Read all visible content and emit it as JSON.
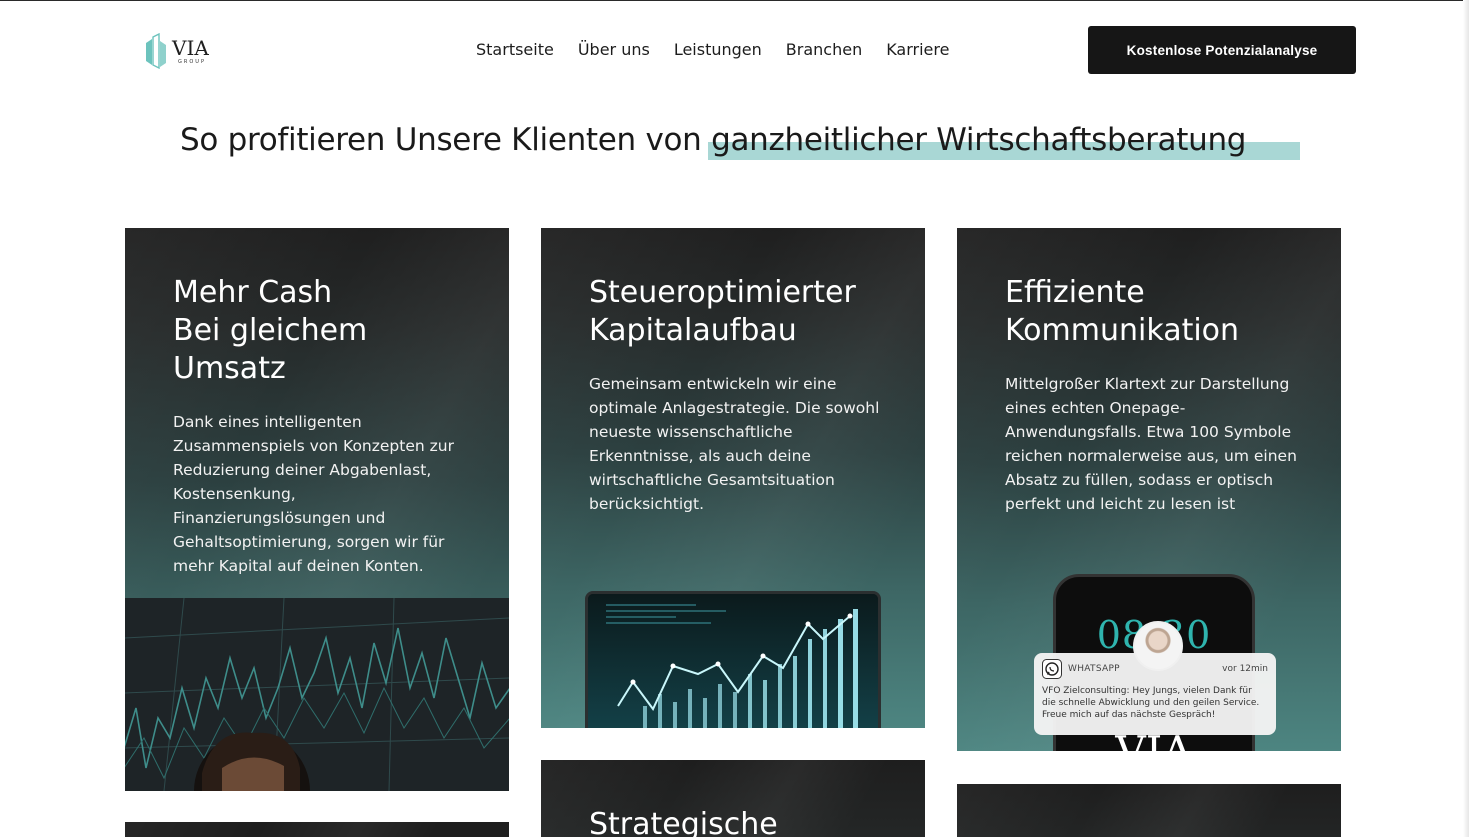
{
  "brand": {
    "logo_text": "VIA",
    "logo_sub": "GROUP",
    "teal": "#a9d7d5",
    "accent": "#2fb4ae"
  },
  "nav": {
    "items": [
      {
        "label": "Startseite"
      },
      {
        "label": "Über uns"
      },
      {
        "label": "Leistungen"
      },
      {
        "label": "Branchen"
      },
      {
        "label": "Karriere"
      }
    ],
    "cta_label": "Kostenlose Potenzialanalyse"
  },
  "headline": {
    "prefix": "So profitieren Unsere Klienten von ",
    "highlighted": "ganzheitlicher Wirtschaftsberatung"
  },
  "cards": [
    {
      "title_lines": [
        "Mehr Cash",
        "Bei gleichem",
        "Umsatz"
      ],
      "text": "Dank eines intelligenten Zusammenspiels von Konzepten zur Reduzierung deiner Abgabenlast, Kostensenkung, Finanzierungslösungen und Gehaltsoptimierung, sorgen wir für mehr Kapital auf deinen Konten."
    },
    {
      "title_lines": [
        "Steueroptimierter",
        "Kapitalaufbau"
      ],
      "text": "Gemeinsam entwickeln wir eine optimale Anlagestrategie. Die sowohl neueste wissenschaftliche Erkenntnisse, als auch deine wirtschaftliche Gesamtsituation berücksichtigt."
    },
    {
      "title_lines": [
        "Effiziente",
        "Kommunikation"
      ],
      "text": "Mittelgroßer Klartext zur Darstellung eines echten Onepage-Anwendungsfalls. Etwa 100 Symbole reichen normalerweise aus, um einen Absatz zu füllen, sodass er optisch perfekt und leicht zu lesen ist",
      "phone": {
        "clock": "08:30",
        "bottom_text": "VIA",
        "notification": {
          "app": "WHATSAPP",
          "time": "vor 12min",
          "message": "VFO Zielconsulting: Hey Jungs, vielen Dank für die schnelle Abwicklung und den geilen Service. Freue mich auf das nächste Gespräch!"
        }
      }
    },
    {
      "title_lines": [
        "Strategische"
      ]
    }
  ]
}
